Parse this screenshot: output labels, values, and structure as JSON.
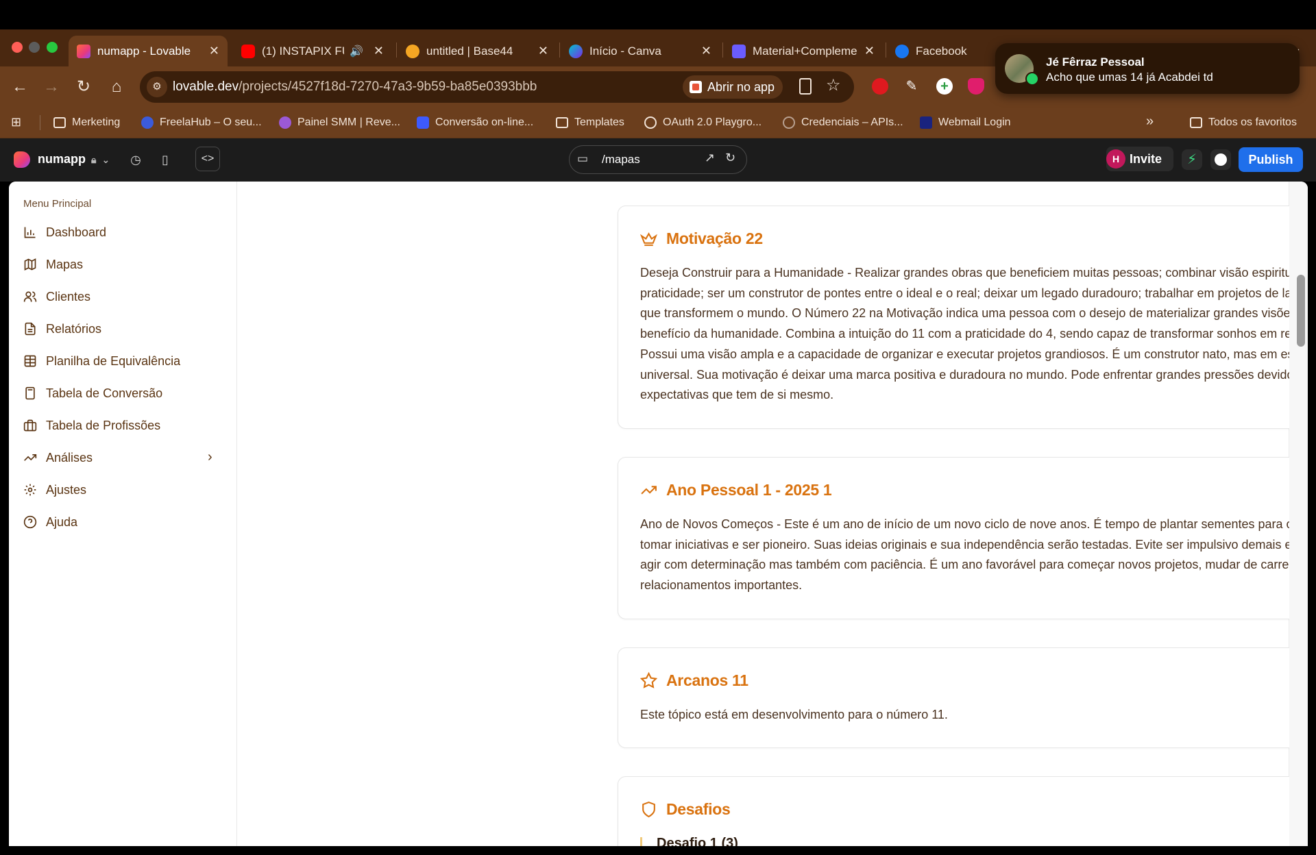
{
  "browser": {
    "tabs": [
      {
        "title": "numapp - Lovable",
        "active": true
      },
      {
        "title": "(1) INSTAPIX FU",
        "active": false
      },
      {
        "title": "untitled | Base44",
        "active": false
      },
      {
        "title": "Início - Canva",
        "active": false
      },
      {
        "title": "Material+Compleme",
        "active": false
      },
      {
        "title": "Facebook",
        "active": false
      }
    ],
    "url_host": "lovable.dev",
    "url_path": "/projects/4527f18d-7270-47a3-9b59-ba85e0393bbb",
    "open_in_app_label": "Abrir no app",
    "bookmarks": [
      "Merketing",
      "FreelaHub – O seu...",
      "Painel SMM | Reve...",
      "Conversão on-line...",
      "Templates",
      "OAuth 2.0 Playgro...",
      "Credenciais – APIs...",
      "Webmail Login"
    ],
    "more_bookmarks": "»",
    "all_favorites": "Todos os favoritos"
  },
  "notification": {
    "sender": "Jé Fêrraz Pessoal",
    "message": "Acho que umas 14 já Acabdei td"
  },
  "lovable": {
    "project_name": "numapp",
    "route": "/mapas",
    "avatar_letter": "H",
    "invite_label": "Invite",
    "publish_label": "Publish"
  },
  "sidebar": {
    "title": "Menu Principal",
    "items": [
      {
        "label": "Dashboard",
        "icon": "bar-chart-icon"
      },
      {
        "label": "Mapas",
        "icon": "map-icon"
      },
      {
        "label": "Clientes",
        "icon": "users-icon"
      },
      {
        "label": "Relatórios",
        "icon": "file-text-icon"
      },
      {
        "label": "Planilha de Equivalência",
        "icon": "table-icon"
      },
      {
        "label": "Tabela de Conversão",
        "icon": "calculator-icon"
      },
      {
        "label": "Tabela de Profissões",
        "icon": "briefcase-icon"
      },
      {
        "label": "Análises",
        "icon": "trending-up-icon"
      },
      {
        "label": "Ajustes",
        "icon": "settings-icon"
      },
      {
        "label": "Ajuda",
        "icon": "help-circle-icon"
      }
    ]
  },
  "cards": [
    {
      "title": "Motivação 22",
      "icon": "crown-icon",
      "text": "Deseja Construir para a Humanidade - Realizar grandes obras que beneficiem muitas pessoas; combinar visão espiritual com praticidade; ser um construtor de pontes entre o ideal e o real; deixar um legado duradouro; trabalhar em projetos de larga escala que transformem o mundo. O Número 22 na Motivação indica uma pessoa com o desejo de materializar grandes visões em benefício da humanidade. Combina a intuição do 11 com a praticidade do 4, sendo capaz de transformar sonhos em realidade. Possui uma visão ampla e a capacidade de organizar e executar projetos grandiosos. É um construtor nato, mas em escala universal. Sua motivação é deixar uma marca positiva e duradoura no mundo. Pode enfrentar grandes pressões devido às altas expectativas que tem de si mesmo."
    },
    {
      "title": "Ano Pessoal 1 - 2025 1",
      "icon": "trending-up-icon",
      "text": "Ano de Novos Começos - Este é um ano de início de um novo ciclo de nove anos. É tempo de plantar sementes para o futuro, tomar iniciativas e ser pioneiro. Suas ideias originais e sua independência serão testadas. Evite ser impulsivo demais e procure agir com determinação mas também com paciência. É um ano favorável para começar novos projetos, mudar de carreira ou iniciar relacionamentos importantes."
    },
    {
      "title": "Arcanos 11",
      "icon": "star-icon",
      "text": "Este tópico está em desenvolvimento para o número 11."
    },
    {
      "title": "Desafios",
      "icon": "shield-icon",
      "sub": "Desafio 1 (3)"
    }
  ],
  "colors": {
    "accent": "#d9720f",
    "browser_frame": "#6b3e1d",
    "publish": "#1f6feb"
  }
}
